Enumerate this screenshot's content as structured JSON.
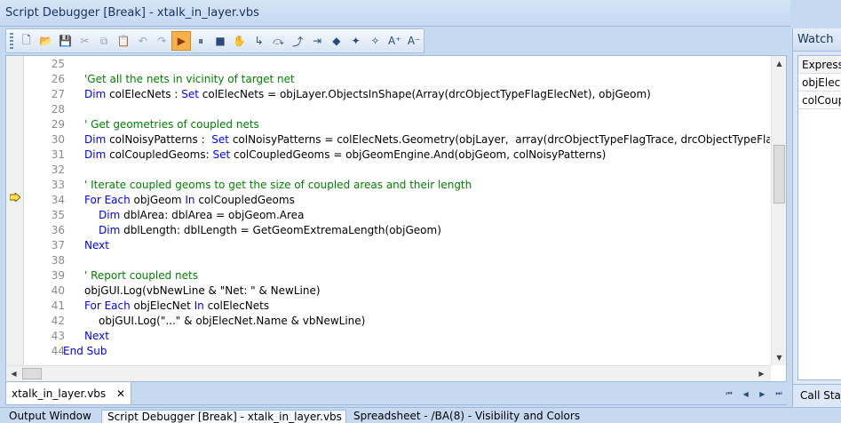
{
  "window": {
    "title": "Script Debugger [Break] - xtalk_in_layer.vbs"
  },
  "toolbar": {
    "buttons": [
      {
        "name": "new-file-icon",
        "glyph": "🗋"
      },
      {
        "name": "open-folder-icon",
        "glyph": "📂"
      },
      {
        "name": "save-icon",
        "glyph": "💾"
      },
      {
        "name": "cut-icon",
        "glyph": "✂"
      },
      {
        "name": "copy-icon",
        "glyph": "⧉"
      },
      {
        "name": "paste-icon",
        "glyph": "📋"
      },
      {
        "name": "undo-icon",
        "glyph": "↶"
      },
      {
        "name": "redo-icon",
        "glyph": "↷"
      },
      {
        "name": "run-icon",
        "glyph": "▶"
      },
      {
        "name": "pause-icon",
        "glyph": "⏸"
      },
      {
        "name": "stop-icon",
        "glyph": "■"
      },
      {
        "name": "hand-icon",
        "glyph": "✋"
      },
      {
        "name": "step-into-icon",
        "glyph": "↳"
      },
      {
        "name": "step-over-icon",
        "glyph": "⤼"
      },
      {
        "name": "step-out-icon",
        "glyph": "⤴"
      },
      {
        "name": "run-to-cursor-icon",
        "glyph": "⇥"
      },
      {
        "name": "toggle-breakpoint-icon",
        "glyph": "◆"
      },
      {
        "name": "clear-breakpoints-icon",
        "glyph": "✦"
      },
      {
        "name": "disable-breakpoints-icon",
        "glyph": "✧"
      },
      {
        "name": "font-increase-icon",
        "glyph": "A⁺"
      },
      {
        "name": "font-decrease-icon",
        "glyph": "A⁻"
      }
    ]
  },
  "editor": {
    "current_line": 34,
    "lines": [
      {
        "n": "25",
        "indent": 1,
        "parts": []
      },
      {
        "n": "26",
        "indent": 1,
        "parts": [
          {
            "t": "'Get all the nets in vicinity of target net",
            "c": "cm"
          }
        ]
      },
      {
        "n": "27",
        "indent": 1,
        "parts": [
          {
            "t": "Dim ",
            "c": "kw"
          },
          {
            "t": "colElecNets : "
          },
          {
            "t": "Set ",
            "c": "kw"
          },
          {
            "t": "colElecNets = objLayer.ObjectsInShape(Array(drcObjectTypeFlagElecNet), objGeom)"
          }
        ]
      },
      {
        "n": "28",
        "indent": 1,
        "parts": []
      },
      {
        "n": "29",
        "indent": 1,
        "parts": [
          {
            "t": "' Get geometries of coupled nets",
            "c": "cm"
          }
        ]
      },
      {
        "n": "30",
        "indent": 1,
        "parts": [
          {
            "t": "Dim ",
            "c": "kw"
          },
          {
            "t": "colNoisyPatterns :  "
          },
          {
            "t": "Set ",
            "c": "kw"
          },
          {
            "t": "colNoisyPatterns = colElecNets.Geometry(objLayer,  array(drcObjectTypeFlagTrace, drcObjectTypeFlagMeta"
          }
        ]
      },
      {
        "n": "31",
        "indent": 1,
        "parts": [
          {
            "t": "Dim ",
            "c": "kw"
          },
          {
            "t": "colCoupledGeoms: "
          },
          {
            "t": "Set ",
            "c": "kw"
          },
          {
            "t": "colCoupledGeoms = objGeomEngine.And(objGeom, colNoisyPatterns)"
          }
        ]
      },
      {
        "n": "32",
        "indent": 1,
        "parts": []
      },
      {
        "n": "33",
        "indent": 1,
        "parts": [
          {
            "t": "' Iterate coupled geoms to get the size of coupled areas and their length",
            "c": "cm"
          }
        ]
      },
      {
        "n": "34",
        "indent": 1,
        "parts": [
          {
            "t": "For Each ",
            "c": "kw"
          },
          {
            "t": "objGeom "
          },
          {
            "t": "In ",
            "c": "kw"
          },
          {
            "t": "colCoupledGeoms"
          }
        ]
      },
      {
        "n": "35",
        "indent": 2,
        "parts": [
          {
            "t": "Dim ",
            "c": "kw"
          },
          {
            "t": "dblArea: dblArea = objGeom.Area"
          }
        ]
      },
      {
        "n": "36",
        "indent": 2,
        "parts": [
          {
            "t": "Dim ",
            "c": "kw"
          },
          {
            "t": "dblLength: dblLength = GetGeomExtremaLength(objGeom)"
          }
        ]
      },
      {
        "n": "37",
        "indent": 1,
        "parts": [
          {
            "t": "Next",
            "c": "kw"
          }
        ]
      },
      {
        "n": "38",
        "indent": 1,
        "parts": []
      },
      {
        "n": "39",
        "indent": 1,
        "parts": [
          {
            "t": "' Report coupled nets",
            "c": "cm"
          }
        ]
      },
      {
        "n": "40",
        "indent": 1,
        "parts": [
          {
            "t": "objGUI.Log(vbNewLine & \"Net: \" & NewLine)"
          }
        ]
      },
      {
        "n": "41",
        "indent": 1,
        "parts": [
          {
            "t": "For Each ",
            "c": "kw"
          },
          {
            "t": "objElecNet "
          },
          {
            "t": "In ",
            "c": "kw"
          },
          {
            "t": "colElecNets"
          }
        ]
      },
      {
        "n": "42",
        "indent": 2,
        "parts": [
          {
            "t": "objGUI.Log(\"...\" & objElecNet.Name & vbNewLine)"
          }
        ]
      },
      {
        "n": "43",
        "indent": 1,
        "parts": [
          {
            "t": "Next",
            "c": "kw"
          }
        ]
      },
      {
        "n": "44",
        "indent": 0,
        "parts": [
          {
            "t": "End Sub",
            "c": "kw"
          }
        ]
      }
    ]
  },
  "doc_tab": {
    "label": "xtalk_in_layer.vbs",
    "close": "✕"
  },
  "nav": [
    "⏮",
    "◀",
    "▶",
    "⏭"
  ],
  "bottom_tabs": [
    {
      "label": "Output Window",
      "active": false
    },
    {
      "label": "Script Debugger [Break] - xtalk_in_layer.vbs",
      "active": true
    },
    {
      "label": "Spreadsheet - /BA(8) - Visibility and Colors",
      "active": false
    }
  ],
  "watch": {
    "title": "Watch",
    "column": "Expression",
    "rows": [
      "objElecNet",
      "colCoupledGeoms"
    ],
    "footer": "Call Stack"
  },
  "colors": {
    "keyword": "#0000ff",
    "comment": "#008000",
    "run_active": "#f7b14a"
  }
}
